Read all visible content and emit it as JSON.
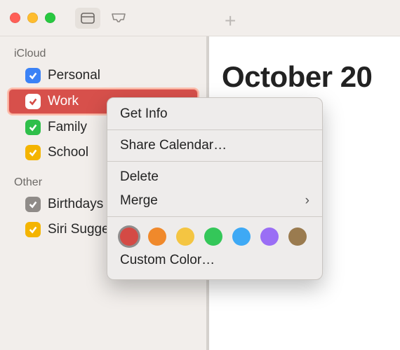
{
  "titlebar": {
    "traffic": [
      "close",
      "minimize",
      "zoom"
    ]
  },
  "sidebar": {
    "groups": [
      {
        "header": "iCloud",
        "items": [
          {
            "label": "Personal",
            "color": "#3b82f6",
            "checked": true,
            "selected": false
          },
          {
            "label": "Work",
            "color": "#d44a45",
            "checked": true,
            "selected": true
          },
          {
            "label": "Family",
            "color": "#2fbf4a",
            "checked": true,
            "selected": false
          },
          {
            "label": "School",
            "color": "#f4b400",
            "checked": true,
            "selected": false
          }
        ]
      },
      {
        "header": "Other",
        "items": [
          {
            "label": "Birthdays",
            "color": "#8f8b88",
            "checked": true,
            "selected": false
          },
          {
            "label": "Siri Suggestions",
            "color": "#f4b400",
            "checked": true,
            "selected": false
          }
        ]
      }
    ]
  },
  "main": {
    "title_visible": "October 20"
  },
  "context_menu": {
    "items": [
      {
        "label": "Get Info",
        "submenu": false
      },
      {
        "label": "Share Calendar…",
        "submenu": false
      },
      {
        "label": "Delete",
        "submenu": false
      },
      {
        "label": "Merge",
        "submenu": true
      },
      {
        "label": "Custom Color…",
        "submenu": false
      }
    ],
    "swatches": [
      {
        "color": "#d44a45",
        "selected": true
      },
      {
        "color": "#f0892b",
        "selected": false
      },
      {
        "color": "#f4c542",
        "selected": false
      },
      {
        "color": "#34c759",
        "selected": false
      },
      {
        "color": "#3ea9f5",
        "selected": false
      },
      {
        "color": "#9a6ef5",
        "selected": false
      },
      {
        "color": "#9a7b4f",
        "selected": false
      }
    ]
  }
}
